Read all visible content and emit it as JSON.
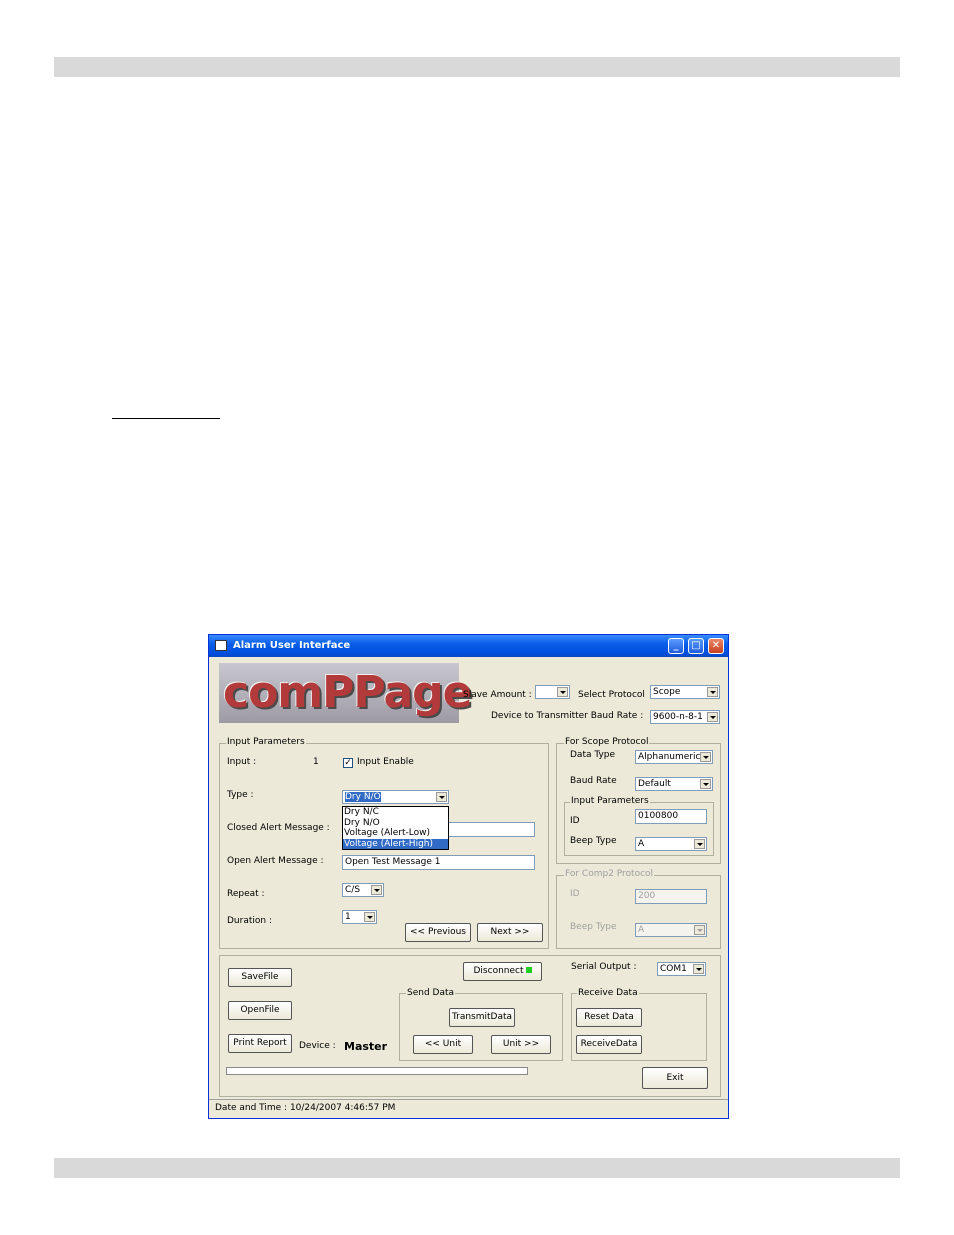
{
  "window": {
    "title": "Alarm User Interface",
    "min": "_",
    "max": "□",
    "close": "✕"
  },
  "logo": "comPPage",
  "top": {
    "slave_amount_label": "Slave Amount :",
    "slave_amount_value": "",
    "select_protocol_label": "Select Protocol",
    "protocol_value": "Scope",
    "baud_label": "Device to Transmitter Baud Rate :",
    "baud_value": "9600-n-8-1"
  },
  "input_params": {
    "title": "Input Parameters",
    "input_label": "Input :",
    "input_value": "1",
    "enable_label": "Input Enable",
    "enable_checked": "✓",
    "type_label": "Type :",
    "type_value": "Dry N/O",
    "type_options": [
      "Dry N/C",
      "Dry N/O",
      "Voltage (Alert-Low)",
      "Voltage (Alert-High)"
    ],
    "closed_label": "Closed Alert Message :",
    "closed_value": "",
    "open_label": "Open Alert Message :",
    "open_value": "Open Test Message 1",
    "repeat_label": "Repeat :",
    "repeat_value": "C/S",
    "duration_label": "Duration :",
    "duration_value": "1",
    "prev_label": "<< Previous",
    "next_label": "Next >>"
  },
  "scope": {
    "title": "For Scope Protocol",
    "data_type_label": "Data Type",
    "data_type_value": "Alphanumeric",
    "baud_label": "Baud Rate",
    "baud_value": "Default",
    "sub_title": "Input Parameters",
    "id_label": "ID",
    "id_value": "0100800",
    "beep_label": "Beep Type",
    "beep_value": "A"
  },
  "comp2": {
    "title": "For Comp2 Protocol",
    "id_label": "ID",
    "id_value": "200",
    "beep_label": "Beep Type",
    "beep_value": "A"
  },
  "bottom": {
    "save_label": "SaveFile",
    "open_label": "OpenFile",
    "print_label": "Print Report",
    "device_label": "Device :",
    "device_value": "Master",
    "disconnect_label": "Disconnect",
    "serial_label": "Serial Output :",
    "serial_value": "COM1",
    "send_title": "Send Data",
    "transmit_label": "TransmitData",
    "unit_prev_label": "<< Unit",
    "unit_next_label": "Unit >>",
    "receive_title": "Receive Data",
    "reset_label": "Reset Data",
    "receive_label": "ReceiveData",
    "exit_label": "Exit"
  },
  "status": "Date and Time : 10/24/2007 4:46:57 PM"
}
